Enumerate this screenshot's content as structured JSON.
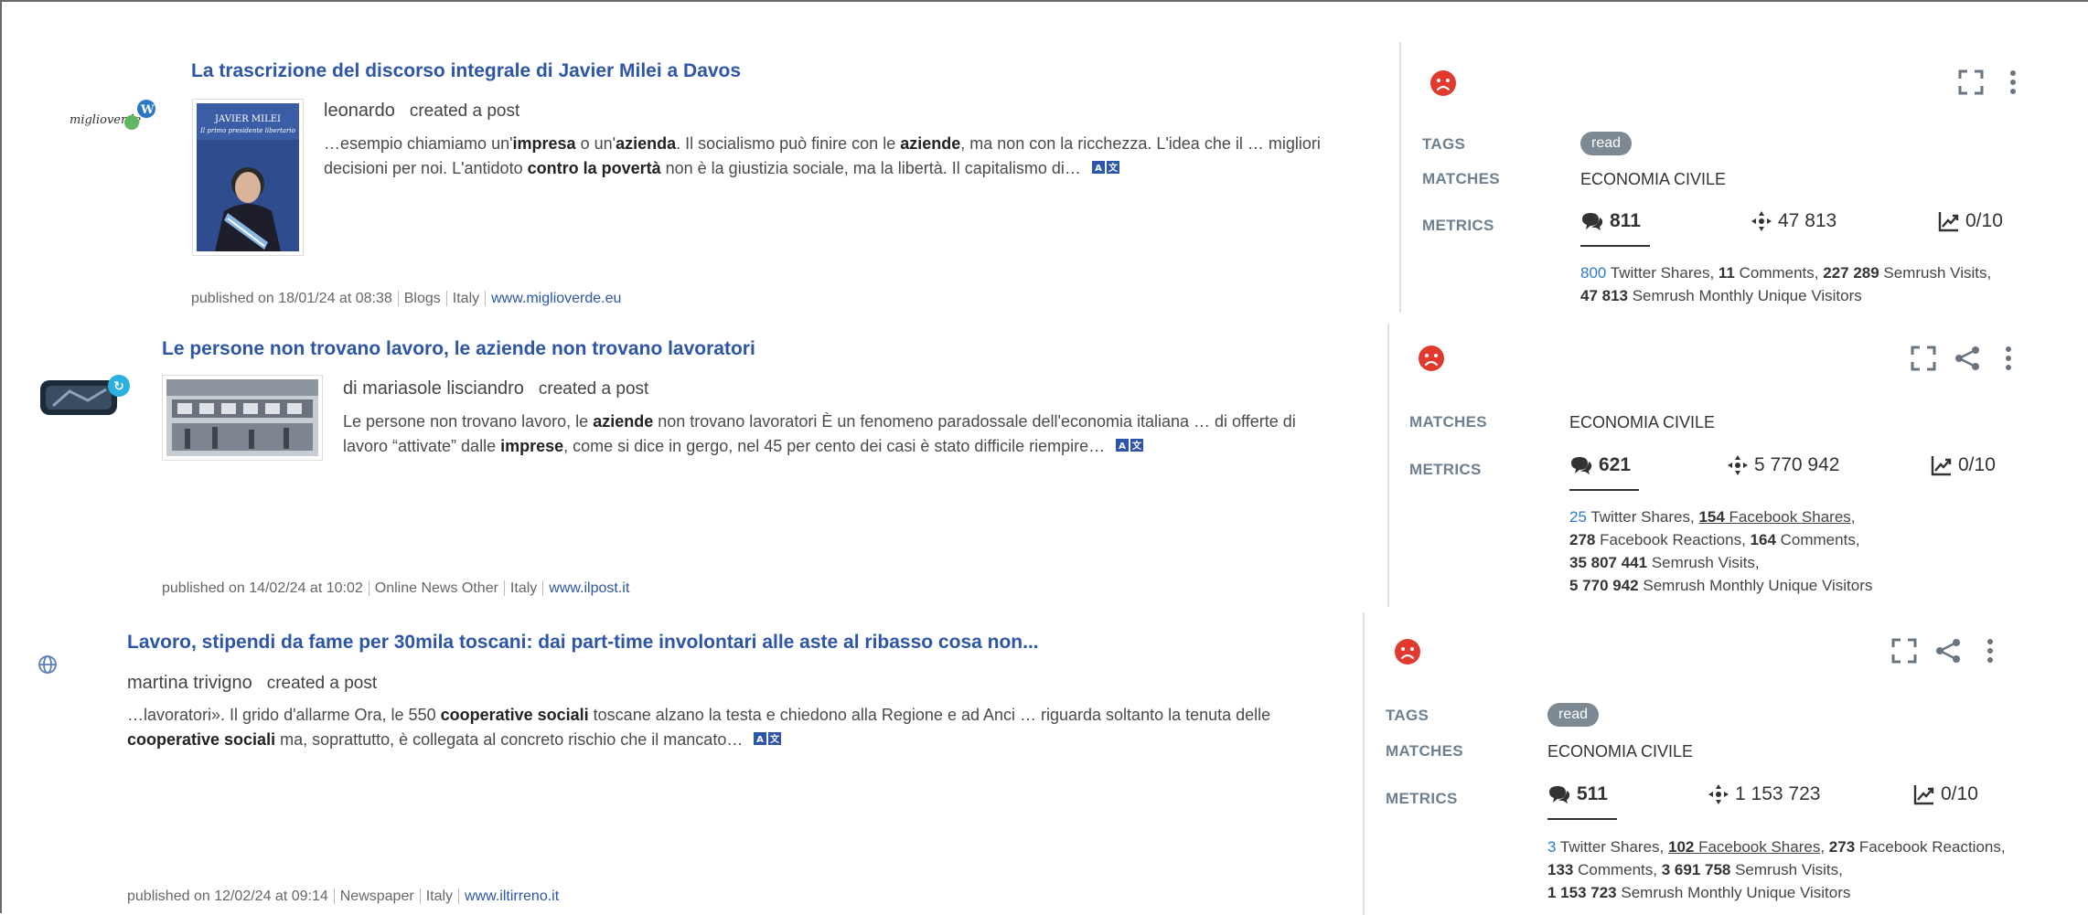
{
  "posts": [
    {
      "title": "La trascrizione del discorso integrale di Javier Milei a Davos",
      "author": "leonardo",
      "verb": "created a post",
      "thumb_title": "JAVIER MILEI",
      "thumb_subtitle": "Il primo presidente libertario",
      "snippet": "…esempio chiamiamo un'<b>impresa</b> o un'<b>azienda</b>. Il socialismo può finire con le <b>aziende</b>, ma non con la ricchezza. L'idea che il … migliori decisioni per noi. L'antidoto <b>contro la povertà</b> non è la giustizia sociale, ma la libertà. Il capitalismo di…",
      "published": "published on 18/01/24 at 08:38",
      "source_type": "Blogs",
      "country": "Italy",
      "domain": "www.miglioverde.eu",
      "source_logo_text": "miglioverde",
      "tags": [
        "read"
      ],
      "matches": "ECONOMIA CIVILE",
      "metric_comments": "811",
      "metric_reach": "47 813",
      "metric_score": "0/10",
      "details_html": "<span class=\"blue\">800</span> Twitter Shares, <b>11</b> Comments, <b>227 289</b> Semrush Visits,<br><b>47 813</b> Semrush Monthly Unique Visitors"
    },
    {
      "title_pre": "Le persone non trovano lavoro, le ",
      "title_bold": "aziende",
      "title_post": " non trovano lavoratori",
      "author": "di mariasole lisciandro",
      "verb": "created a post",
      "snippet": "Le persone non trovano lavoro, le <b>aziende</b> non trovano lavoratori È un fenomeno paradossale dell'economia italiana … di offerte di lavoro “attivate” dalle <b>imprese</b>, come si dice in gergo, nel 45 per cento dei casi è stato difficile riempire…",
      "published": "published on 14/02/24 at 10:02",
      "source_type": "Online News Other",
      "country": "Italy",
      "domain": "www.ilpost.it",
      "matches": "ECONOMIA CIVILE",
      "metric_comments": "621",
      "metric_reach": "5 770 942",
      "metric_score": "0/10",
      "details_html": "<span class=\"blue\">25</span> Twitter Shares, <span class=\"u\"><b>154</b> Facebook Shares,</span><br><b>278</b> Facebook Reactions, <b>164</b> Comments,<br><b>35 807 441</b> Semrush Visits,<br><b>5 770 942</b> Semrush Monthly Unique Visitors"
    },
    {
      "title": "Lavoro, stipendi da fame per 30mila toscani: dai part-time involontari alle aste al ribasso cosa non...",
      "author": "martina trivigno",
      "verb": "created a post",
      "snippet": "…lavoratori». Il grido d'allarme Ora, le 550 <b>cooperative sociali</b> toscane alzano la testa e chiedono alla Regione e ad Anci … riguarda soltanto la tenuta delle <b>cooperative sociali</b> ma, soprattutto, è collegata al concreto rischio che il mancato…",
      "published": "published on 12/02/24 at 09:14",
      "source_type": "Newspaper",
      "country": "Italy",
      "domain": "www.iltirreno.it",
      "tags": [
        "read"
      ],
      "matches": "ECONOMIA CIVILE",
      "metric_comments": "511",
      "metric_reach": "1 153 723",
      "metric_score": "0/10",
      "details_html": "<span class=\"blue\">3</span> Twitter Shares, <span class=\"u\"><b>102</b> Facebook Shares,</span> <b>273</b> Facebook Reactions,<br><b>133</b> Comments, <b>3 691 758</b> Semrush Visits,<br><b>1 153 723</b> Semrush Monthly Unique Visitors"
    }
  ],
  "labels": {
    "tags": "TAGS",
    "matches": "MATCHES",
    "metrics": "METRICS"
  },
  "icons": {
    "sentiment": "sad-face-icon",
    "expand": "expand-icon",
    "share": "share-icon",
    "menu": "kebab-menu-icon",
    "comments": "comments-icon",
    "reach": "reach-icon",
    "score": "trend-icon",
    "translate": "translate-icon"
  },
  "colors": {
    "title": "#2d55a8",
    "sentiment_negative": "#e03a2f",
    "tag_bg": "#7d8993",
    "label": "#6e7f8f",
    "link": "#2d7ad0"
  }
}
